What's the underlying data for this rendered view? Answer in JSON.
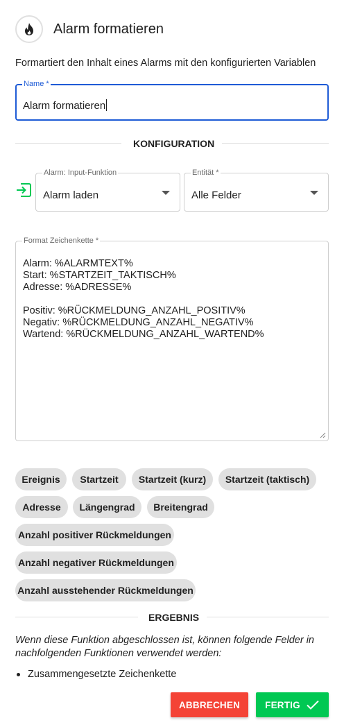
{
  "header": {
    "title": "Alarm formatieren",
    "icon": "flame-icon"
  },
  "description": "Formartiert den Inhalt eines Alarms mit den konfigurierten Variablen",
  "name_field": {
    "label": "Name *",
    "value": "Alarm formatieren"
  },
  "configuration": {
    "title": "KONFIGURATION",
    "input_icon": "input-arrow-icon",
    "input_function": {
      "label": "Alarm: Input-Funktion",
      "value": "Alarm laden"
    },
    "entity": {
      "label": "Entität *",
      "value": "Alle Felder"
    },
    "format": {
      "label": "Format Zeichenkette *",
      "value": "Alarm: %ALARMTEXT%\nStart: %STARTZEIT_TAKTISCH%\nAdresse: %ADRESSE%\n\nPositiv: %RÜCKMELDUNG_ANZAHL_POSITIV%\nNegativ: %RÜCKMELDUNG_ANZAHL_NEGATIV%\nWartend: %RÜCKMELDUNG_ANZAHL_WARTEND%"
    }
  },
  "chips": [
    "Ereignis",
    "Startzeit",
    "Startzeit (kurz)",
    "Startzeit (taktisch)",
    "Adresse",
    "Längengrad",
    "Breitengrad",
    "Anzahl positiver Rückmeldungen",
    "Anzahl negativer Rückmeldungen",
    "Anzahl ausstehender Rückmeldungen"
  ],
  "result": {
    "title": "ERGEBNIS",
    "text": "Wenn diese Funktion abgeschlossen ist, können folgende Felder in nachfolgenden Funktionen verwendet werden:",
    "items": [
      "Zusammengesetzte Zeichenkette"
    ]
  },
  "buttons": {
    "cancel": "ABBRECHEN",
    "done": "FERTIG",
    "cancel_color": "#f44336",
    "done_color": "#00c853"
  }
}
